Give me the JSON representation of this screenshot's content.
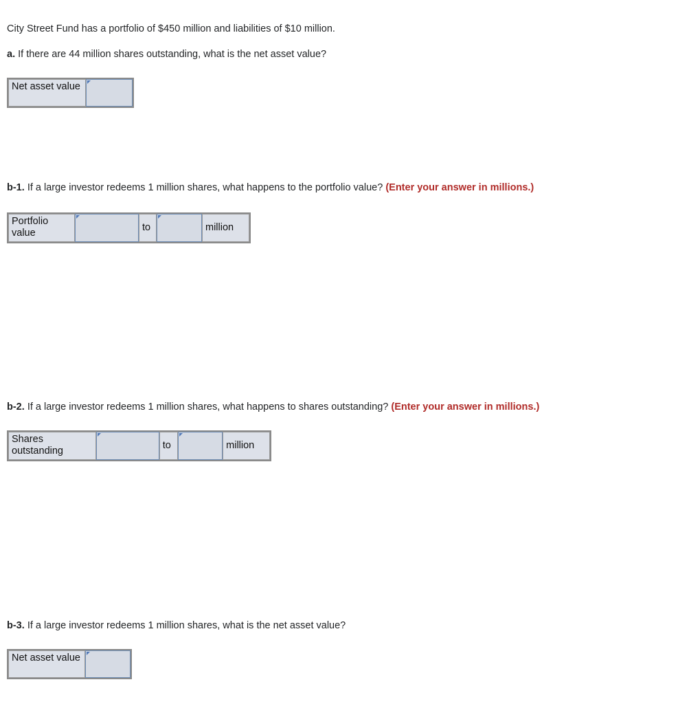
{
  "intro": {
    "text": "City Street Fund has a portfolio of $450 million and liabilities of $10 million."
  },
  "colors": {
    "hint_red": "#b02b28",
    "input_fill": "#d6dbe4",
    "input_border": "#6d8cb4",
    "label_fill": "#dde1e9",
    "table_border": "#8a8a8a",
    "marker_blue": "#5179b8"
  },
  "questions": [
    {
      "label": "a.",
      "text": "If there are 44 million shares outstanding, what is the net asset value?",
      "hint": "",
      "table": {
        "row_label": "Net asset value",
        "inputs": [
          {
            "value": "",
            "placeholder": ""
          }
        ],
        "join_text": "",
        "unit": ""
      }
    },
    {
      "label": "b-1.",
      "text": "If a large investor redeems 1 million shares, what happens to the portfolio value?",
      "hint": "(Enter your answer in millions.)",
      "table": {
        "row_label": "Portfolio value",
        "inputs": [
          {
            "value": "",
            "placeholder": ""
          },
          {
            "value": "",
            "placeholder": ""
          }
        ],
        "join_text": "to",
        "unit": "million"
      }
    },
    {
      "label": "b-2.",
      "text": "If a large investor redeems 1 million shares, what happens to shares outstanding?",
      "hint": "(Enter your answer in millions.)",
      "table": {
        "row_label": "Shares outstanding",
        "inputs": [
          {
            "value": "",
            "placeholder": ""
          },
          {
            "value": "",
            "placeholder": ""
          }
        ],
        "join_text": "to",
        "unit": "million"
      }
    },
    {
      "label": "b-3.",
      "text": "If a large investor redeems 1 million shares, what is the net asset value?",
      "hint": "",
      "table": {
        "row_label": "Net asset value",
        "inputs": [
          {
            "value": "",
            "placeholder": ""
          }
        ],
        "join_text": "",
        "unit": ""
      }
    }
  ]
}
